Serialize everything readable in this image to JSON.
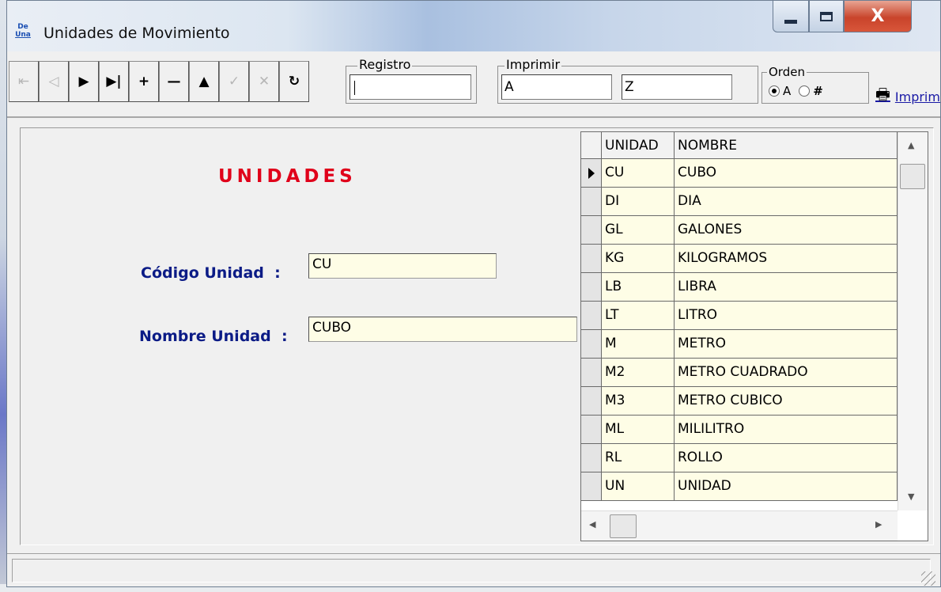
{
  "window": {
    "title": "Unidades de Movimiento",
    "icon_top": "De",
    "icon_bottom": "Una",
    "close_label": "X"
  },
  "toolbar": {
    "nav_buttons": [
      {
        "name": "first-record",
        "icon": "first-icon",
        "glyph": "⇤",
        "enabled": false
      },
      {
        "name": "prev-record",
        "icon": "prev-icon",
        "glyph": "◁",
        "enabled": false
      },
      {
        "name": "next-record",
        "icon": "next-icon",
        "glyph": "▶",
        "enabled": true
      },
      {
        "name": "last-record",
        "icon": "last-icon",
        "glyph": "▶|",
        "enabled": true
      },
      {
        "name": "insert-record",
        "icon": "plus-icon",
        "glyph": "+",
        "enabled": true
      },
      {
        "name": "delete-record",
        "icon": "minus-icon",
        "glyph": "—",
        "enabled": true
      },
      {
        "name": "edit-record",
        "icon": "up-icon",
        "glyph": "▲",
        "enabled": true
      },
      {
        "name": "post-record",
        "icon": "check-icon",
        "glyph": "✓",
        "enabled": false
      },
      {
        "name": "cancel-record",
        "icon": "cancel-icon",
        "glyph": "✕",
        "enabled": false
      },
      {
        "name": "refresh-record",
        "icon": "refresh-icon",
        "glyph": "↻",
        "enabled": true
      }
    ],
    "registro_label": "Registro",
    "registro_value": "",
    "imprimir_label": "Imprimir",
    "imprimir_from": "A",
    "imprimir_to": "Z",
    "orden_label": "Orden",
    "orden_option_alpha": "A",
    "orden_option_num": "#",
    "orden_selected": "A",
    "print_link": "Imprimi"
  },
  "form": {
    "heading": "UNIDADES",
    "codigo_label": "Código Unidad",
    "codigo_value": "CU",
    "nombre_label": "Nombre Unidad",
    "nombre_value": "CUBO",
    "colon": ":"
  },
  "grid": {
    "columns": [
      "UNIDAD",
      "NOMBRE"
    ],
    "rows": [
      [
        "CU",
        "CUBO"
      ],
      [
        "DI",
        "DIA"
      ],
      [
        "GL",
        "GALONES"
      ],
      [
        "KG",
        "KILOGRAMOS"
      ],
      [
        "LB",
        "LIBRA"
      ],
      [
        "LT",
        "LITRO"
      ],
      [
        "M",
        "METRO"
      ],
      [
        "M2",
        "METRO CUADRADO"
      ],
      [
        "M3",
        "METRO CUBICO"
      ],
      [
        "ML",
        "MILILITRO"
      ],
      [
        "RL",
        "ROLLO"
      ],
      [
        "UN",
        "UNIDAD"
      ]
    ],
    "selected_row": 0
  },
  "colors": {
    "heading": "#e0001a",
    "label": "#0b1b86",
    "cell_bg": "#fefde6"
  }
}
